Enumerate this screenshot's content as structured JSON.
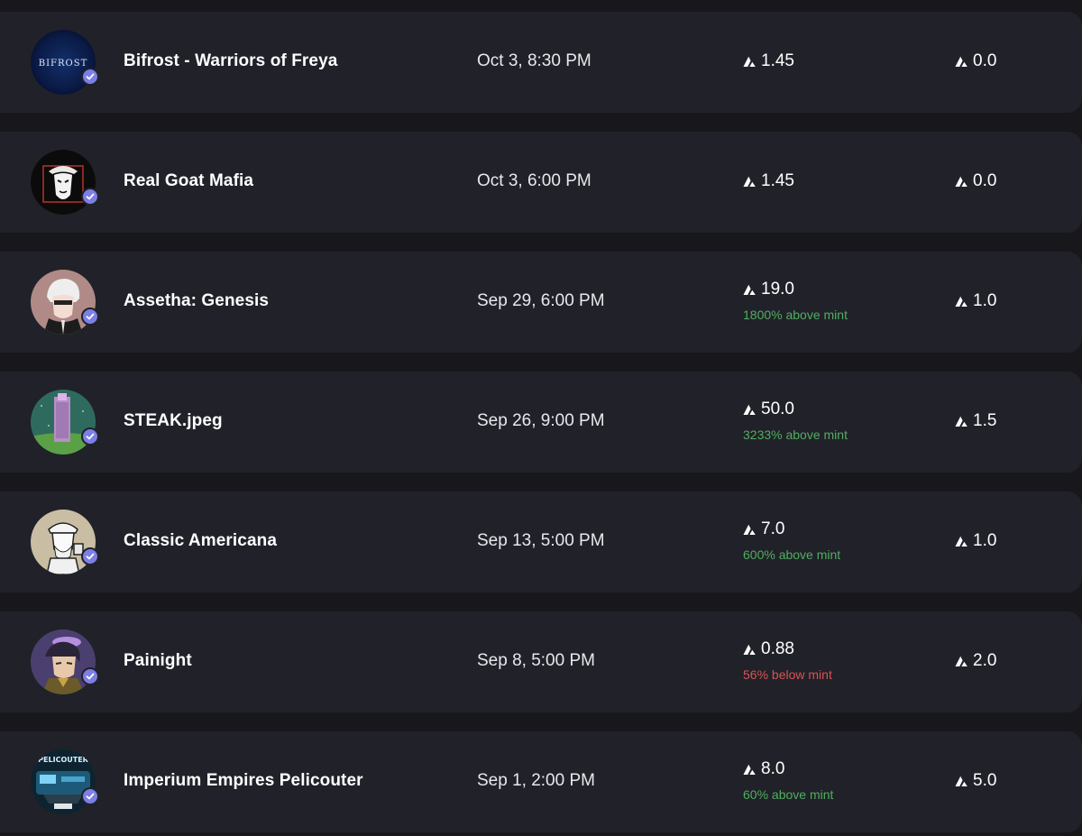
{
  "rows": [
    {
      "name": "Bifrost - Warriors of Freya",
      "date": "Oct 3, 8:30 PM",
      "price": "1.45",
      "delta": "",
      "delta_type": "",
      "floor": "0.0",
      "avatar": "bifrost",
      "avatar_text": "BIFROST"
    },
    {
      "name": "Real Goat Mafia",
      "date": "Oct 3, 6:00 PM",
      "price": "1.45",
      "delta": "",
      "delta_type": "",
      "floor": "0.0",
      "avatar": "goat"
    },
    {
      "name": "Assetha: Genesis",
      "date": "Sep 29, 6:00 PM",
      "price": "19.0",
      "delta": "1800% above mint",
      "delta_type": "above",
      "floor": "1.0",
      "avatar": "assetha"
    },
    {
      "name": "STEAK.jpeg",
      "date": "Sep 26, 9:00 PM",
      "price": "50.0",
      "delta": "3233% above mint",
      "delta_type": "above",
      "floor": "1.5",
      "avatar": "steak"
    },
    {
      "name": "Classic Americana",
      "date": "Sep 13, 5:00 PM",
      "price": "7.0",
      "delta": "600% above mint",
      "delta_type": "above",
      "floor": "1.0",
      "avatar": "americana"
    },
    {
      "name": "Painight",
      "date": "Sep 8, 5:00 PM",
      "price": "0.88",
      "delta": "56% below mint",
      "delta_type": "below",
      "floor": "2.0",
      "avatar": "painight"
    },
    {
      "name": "Imperium Empires Pelicouter",
      "date": "Sep 1, 2:00 PM",
      "price": "8.0",
      "delta": "60% above mint",
      "delta_type": "above",
      "floor": "5.0",
      "avatar": "pelicouter",
      "avatar_text": "PELICOUTER"
    }
  ],
  "colors": {
    "background": "#17171c",
    "row": "#212129",
    "verified": "#7b7fe6",
    "above": "#4fae5e",
    "below": "#d9534f"
  },
  "icons": {
    "currency": "avax-icon",
    "verified": "verified-check-icon"
  }
}
